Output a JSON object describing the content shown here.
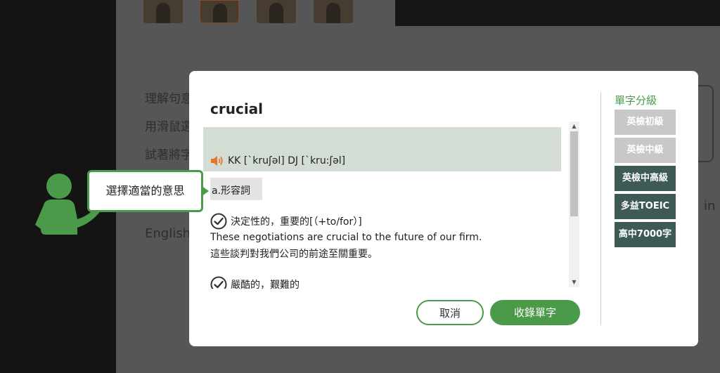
{
  "background": {
    "lines": [
      "理解句意",
      "用滑鼠選",
      "試著將字"
    ],
    "english_label": "English",
    "right_fragment": "in"
  },
  "modal": {
    "word": "crucial",
    "pronunciation": "KK [ˋkruʃəl] DJ [ˋkru:ʃəl]",
    "part_of_speech": "a.形容詞",
    "definitions": [
      {
        "meaning": "決定性的，重要的[（+to/for）]",
        "example_en": "These negotiations are crucial to the future of our firm.",
        "example_zh": "這些談判對我們公司的前途至關重要。"
      },
      {
        "meaning": "嚴酷的，艱難的"
      }
    ],
    "buttons": {
      "cancel": "取消",
      "collect": "收錄單字"
    },
    "levels": {
      "title": "單字分級",
      "items": [
        {
          "label": "英檢初級",
          "active": false
        },
        {
          "label": "英檢中級",
          "active": false
        },
        {
          "label": "英檢中高級",
          "active": true
        },
        {
          "label": "多益TOEIC",
          "active": true
        },
        {
          "label": "高中7000字",
          "active": true
        }
      ]
    }
  },
  "tip": {
    "bubble_text": "選擇適當的意思"
  },
  "colors": {
    "accent": "#4a9a4a",
    "level_active": "#3d5a55",
    "level_inactive": "#c8c8c8",
    "pron_band": "#d4ddd4"
  }
}
